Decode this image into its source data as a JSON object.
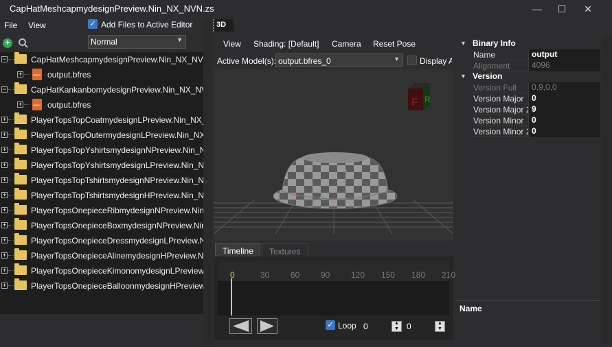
{
  "window": {
    "title": "CapHatMeshcapmydesignPreview.Nin_NX_NVN.zs"
  },
  "menu": {
    "file": "File",
    "view": "View"
  },
  "toolbar": {
    "add_files_label": "Add Files to Active Editor",
    "add_files_checked": true,
    "mode_value": "Normal"
  },
  "tree": {
    "items": [
      {
        "label": "CapHatMeshcapmydesignPreview.Nin_NX_NVN.zs",
        "type": "folder",
        "level": 0
      },
      {
        "label": "output.bfres",
        "type": "file",
        "level": 1
      },
      {
        "label": "CapHatKankanbomydesignPreview.Nin_NX_NVN.zs",
        "type": "folder",
        "level": 0
      },
      {
        "label": "output.bfres",
        "type": "file",
        "level": 1
      },
      {
        "label": "PlayerTopsTopCoatmydesignLPreview.Nin_NX_NVN",
        "type": "folder",
        "level": 0
      },
      {
        "label": "PlayerTopsTopOutermydesignLPreview.Nin_NX_NVN",
        "type": "folder",
        "level": 0
      },
      {
        "label": "PlayerTopsTopYshirtsmydesignNPreview.Nin_NX_NVN",
        "type": "folder",
        "level": 0
      },
      {
        "label": "PlayerTopsTopYshirtsmydesignLPreview.Nin_NX_NVN",
        "type": "folder",
        "level": 0
      },
      {
        "label": "PlayerTopsTopTshirtsmydesignNPreview.Nin_NX_NVN",
        "type": "folder",
        "level": 0
      },
      {
        "label": "PlayerTopsTopTshirtsmydesignHPreview.Nin_NX_NVN",
        "type": "folder",
        "level": 0
      },
      {
        "label": "PlayerTopsOnepieceRibmydesignNPreview.Nin_NX_NVN",
        "type": "folder",
        "level": 0
      },
      {
        "label": "PlayerTopsOnepieceBoxmydesignNPreview.Nin_NX_NVN",
        "type": "folder",
        "level": 0
      },
      {
        "label": "PlayerTopsOnepieceDressmydesignLPreview.Nin_NX_NVN",
        "type": "folder",
        "level": 0
      },
      {
        "label": "PlayerTopsOnepieceAlinemydesignHPreview.Nin_NX_NVN",
        "type": "folder",
        "level": 0
      },
      {
        "label": "PlayerTopsOnepieceKimonomydesignLPreview.Nin_NX_NVN",
        "type": "folder",
        "level": 0
      },
      {
        "label": "PlayerTopsOnepieceBalloonmydesignHPreview.Nin_NX_NVN",
        "type": "folder",
        "level": 0
      }
    ]
  },
  "viewer": {
    "tab_label": "3D",
    "menu": {
      "view": "View",
      "shading": "Shading: [Default]",
      "camera": "Camera",
      "reset_pose": "Reset Pose"
    },
    "active_models_label": "Active Model(s):",
    "active_model_value": "output.bfres_0",
    "display_all_label": "Display Al",
    "gizmo_letters": {
      "front": "F",
      "right": "R"
    }
  },
  "timeline": {
    "tabs": [
      {
        "label": "Timeline",
        "active": true
      },
      {
        "label": "Textures",
        "active": false
      }
    ],
    "ticks": [
      "0",
      "30",
      "60",
      "90",
      "120",
      "150",
      "180",
      "210"
    ],
    "loop_label": "Loop",
    "loop_checked": true,
    "frame_value": "0",
    "stepper_value": "0"
  },
  "properties": {
    "sections": [
      {
        "title": "Binary Info",
        "rows": [
          {
            "key": "Name",
            "value": "output",
            "dim": false
          },
          {
            "key": "Alignment",
            "value": "4096",
            "dim": true
          }
        ]
      },
      {
        "title": "Version",
        "rows": [
          {
            "key": "Version Full",
            "value": "0,9,0,0",
            "dim": true
          },
          {
            "key": "Version Major",
            "value": "0",
            "dim": false
          },
          {
            "key": "Version Major 2",
            "value": "9",
            "dim": false
          },
          {
            "key": "Version Minor",
            "value": "0",
            "dim": false
          },
          {
            "key": "Version Minor 2",
            "value": "0",
            "dim": false
          }
        ]
      }
    ],
    "footer_title": "Name"
  },
  "colors": {
    "accent": "#3b78c4",
    "folder": "#e8c25e",
    "file": "#e06a2c",
    "playhead": "#e8c25e"
  }
}
